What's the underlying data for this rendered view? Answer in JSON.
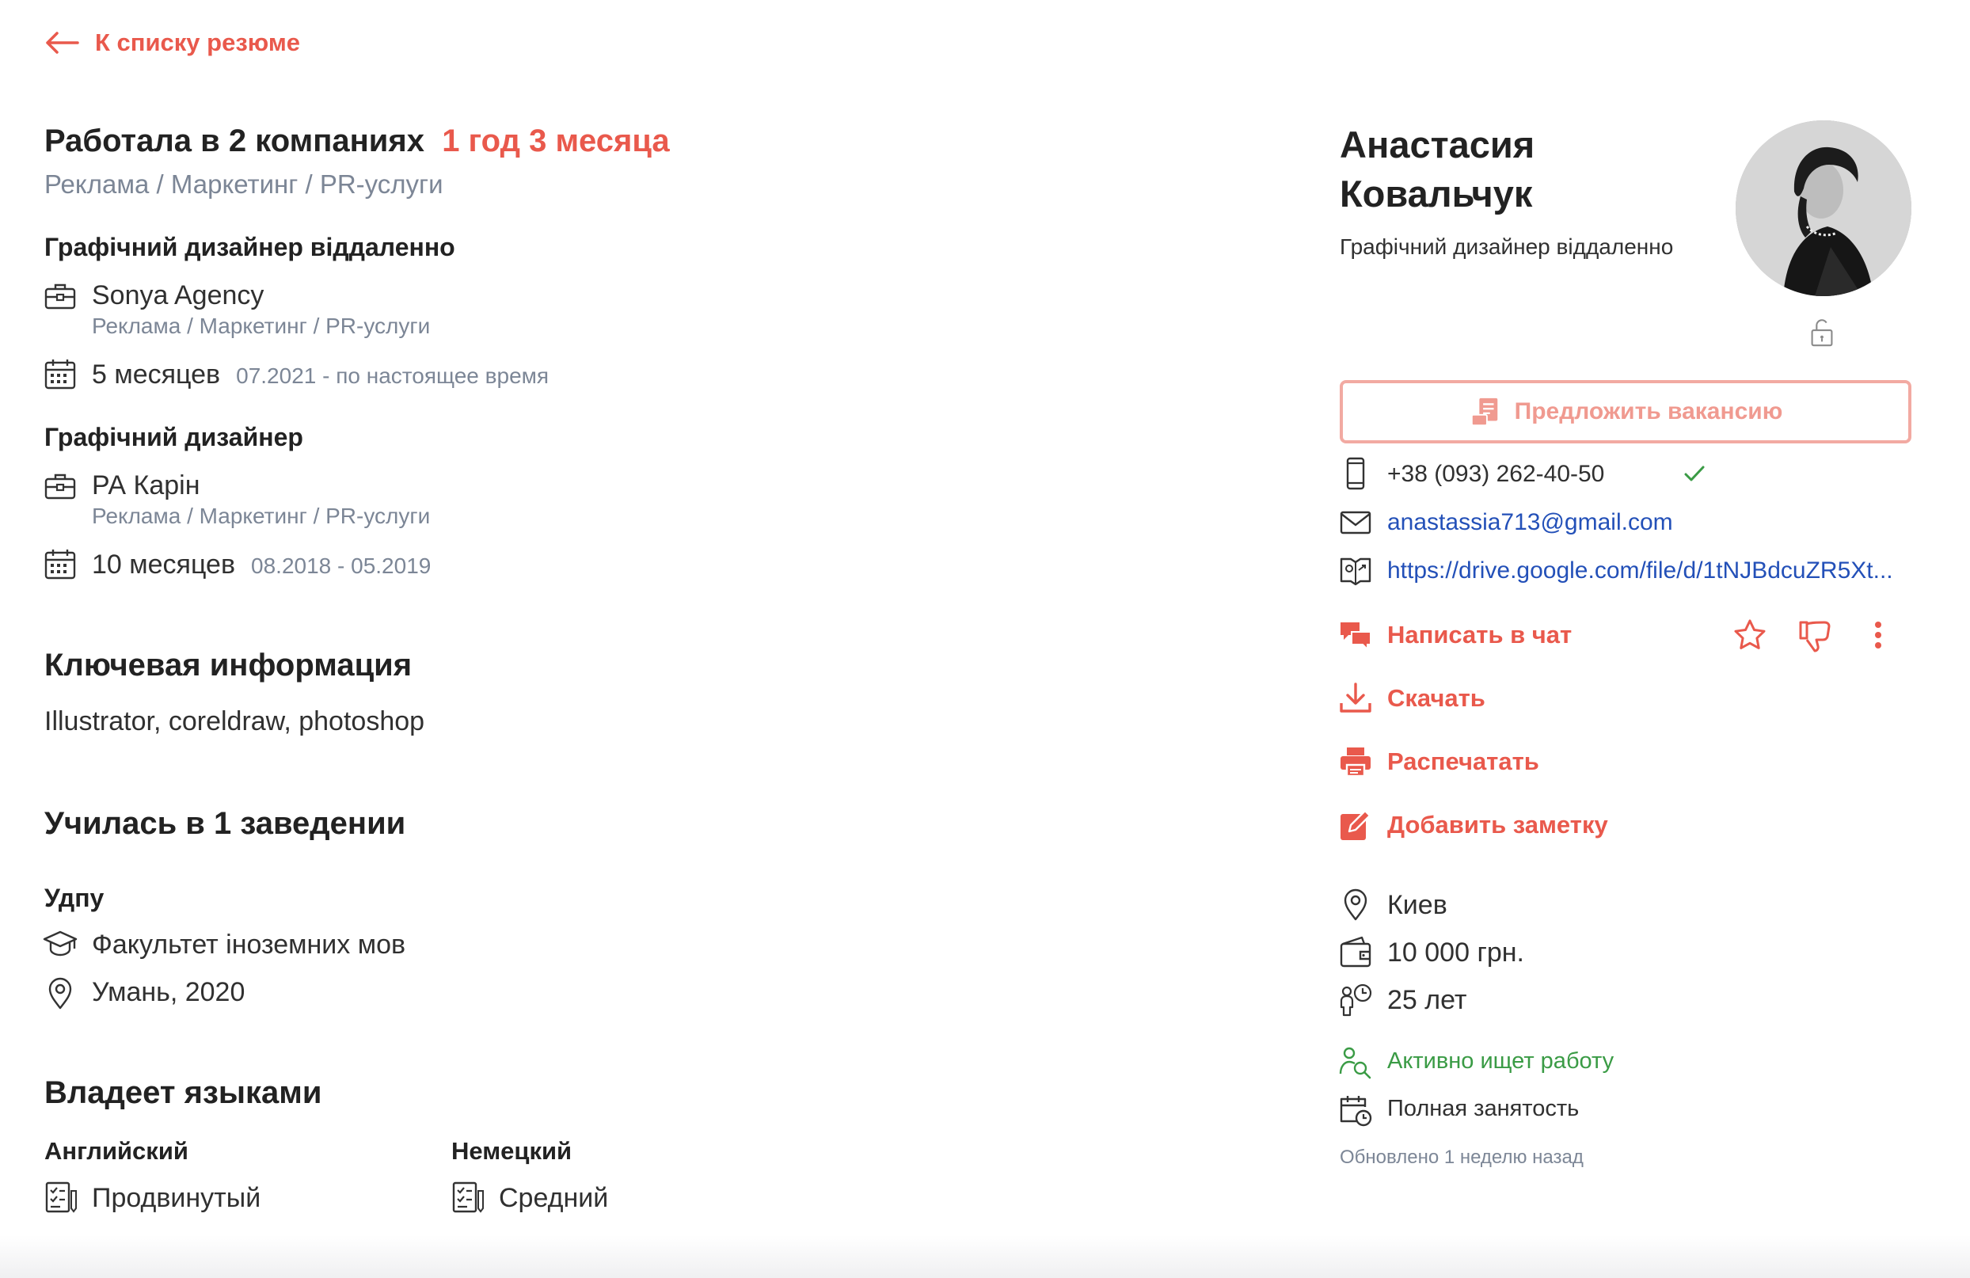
{
  "back_link": "К списку резюме",
  "experience": {
    "title": "Работала в 2 компаниях",
    "duration": "1 год 3 месяца",
    "industry": "Реклама / Маркетинг / PR-услуги",
    "jobs": [
      {
        "title": "Графічний дизайнер віддаленно",
        "company": "Sonya Agency",
        "industry": "Реклама / Маркетинг / PR-услуги",
        "duration": "5 месяцев",
        "period": "07.2021 - по настоящее время"
      },
      {
        "title": "Графічний дизайнер",
        "company": "РА Карін",
        "industry": "Реклама / Маркетинг / PR-услуги",
        "duration": "10 месяцев",
        "period": "08.2018 - 05.2019"
      }
    ]
  },
  "key_info": {
    "title": "Ключевая информация",
    "text": "Illustrator, coreldraw, photoshop"
  },
  "education": {
    "title": "Училась в 1 заведении",
    "institution": "Удпу",
    "faculty": "Факультет іноземних мов",
    "place_year": "Умань, 2020"
  },
  "languages": {
    "title": "Владеет языками",
    "items": [
      {
        "name": "Английский",
        "level": "Продвинутый"
      },
      {
        "name": "Немецкий",
        "level": "Средний"
      }
    ]
  },
  "profile": {
    "name_line1": "Анастасия",
    "name_line2": "Ковальчук",
    "position": "Графічний дизайнер віддаленно",
    "offer_button": "Предложить вакансию",
    "phone": "+38 (093) 262-40-50",
    "email": "anastassia713@gmail.com",
    "portfolio_link": "https://drive.google.com/file/d/1tNJBdcuZR5Xt...",
    "actions": {
      "chat": "Написать в чат",
      "download": "Скачать",
      "print": "Распечатать",
      "note": "Добавить заметку"
    },
    "city": "Киев",
    "salary": "10 000 грн.",
    "age": "25 лет",
    "search_status": "Активно ищет работу",
    "employment": "Полная занятость",
    "updated": "Обновлено 1 неделю назад"
  },
  "colors": {
    "accent": "#e9594c",
    "accent_light": "#f2aaa2",
    "link": "#2350b8",
    "green": "#3a9b45",
    "muted": "#7c8696",
    "text": "#303030"
  },
  "icons": [
    "arrow-left-icon",
    "briefcase-icon",
    "calendar-icon",
    "graduation-cap-icon",
    "location-pin-icon",
    "checklist-icon",
    "unlock-icon",
    "offer-document-icon",
    "phone-icon",
    "check-icon",
    "envelope-icon",
    "portfolio-link-icon",
    "chat-icon",
    "star-icon",
    "thumbs-down-icon",
    "more-vertical-icon",
    "download-icon",
    "printer-icon",
    "edit-note-icon",
    "wallet-icon",
    "person-clock-icon",
    "person-search-icon",
    "calendar-clock-icon"
  ]
}
